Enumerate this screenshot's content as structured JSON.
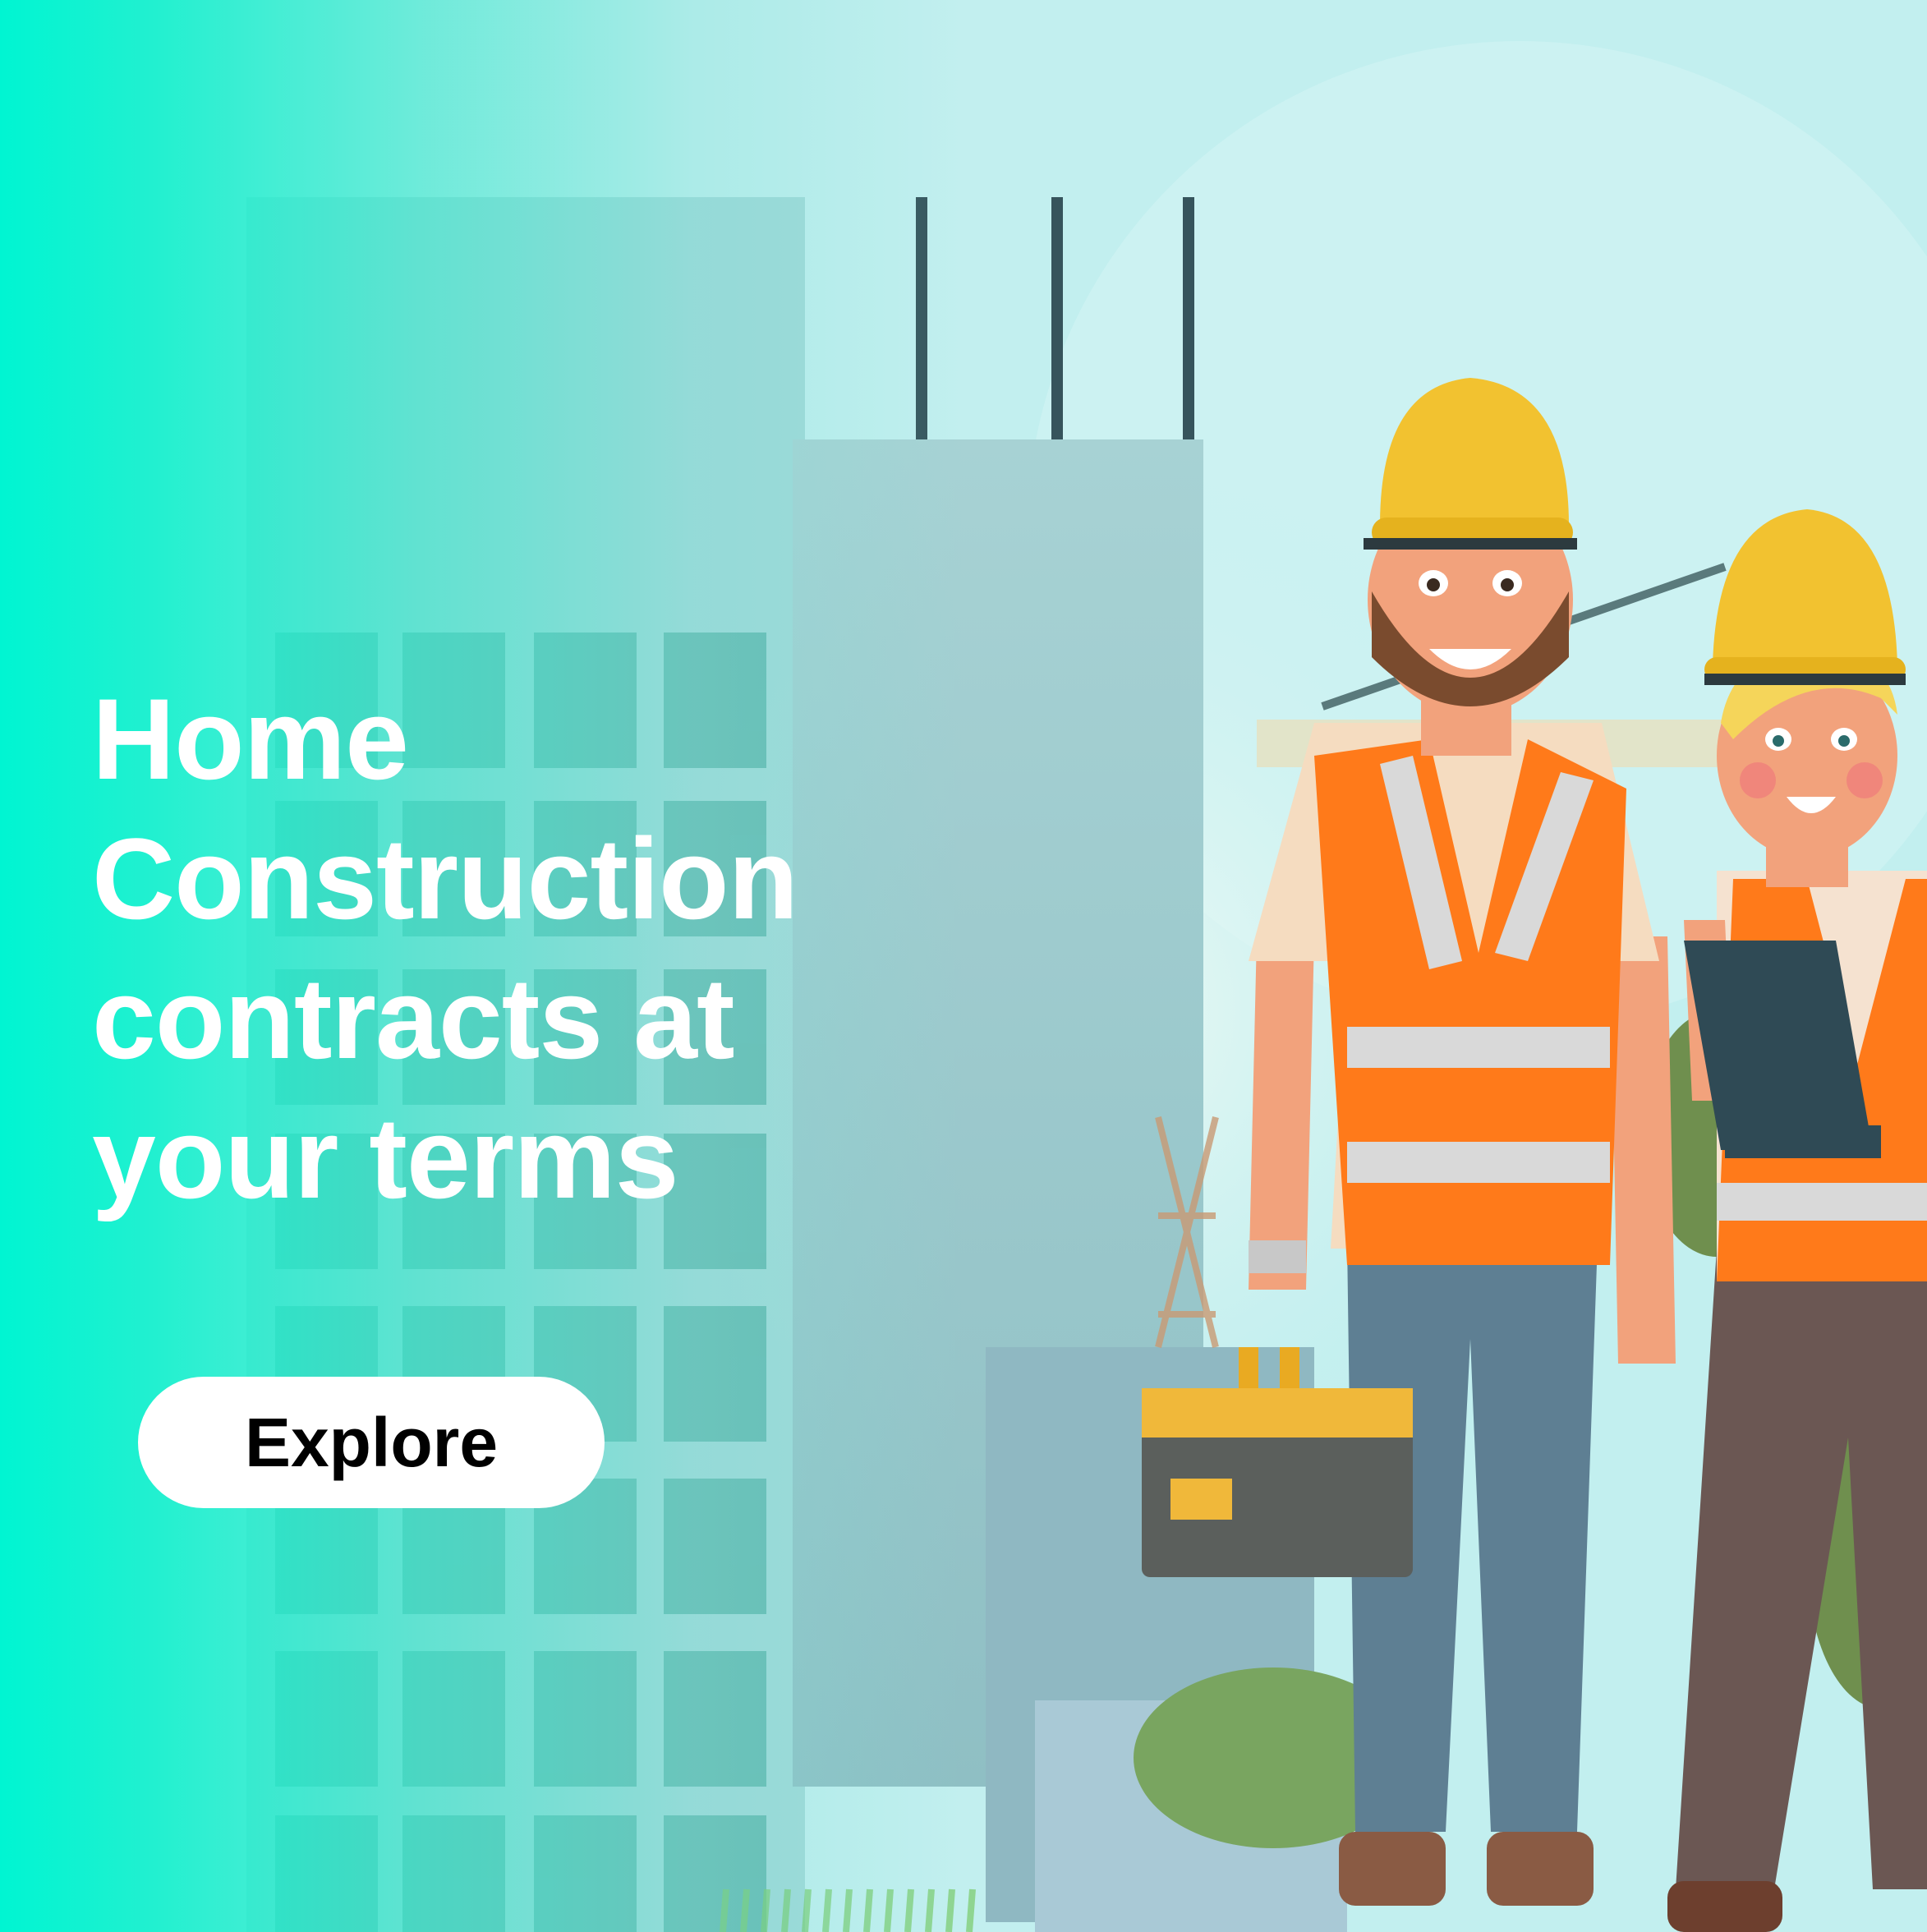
{
  "banner": {
    "headline_lines": [
      "Home",
      "Construction",
      "contracts at",
      "your terms"
    ],
    "cta_label": "Explore"
  },
  "illustration": {
    "subject": "two construction workers in hard hats and safety vests in front of a building under construction",
    "icons": [
      "hard-hat-icon",
      "toolbox-icon",
      "clipboard-icon",
      "crane-icon",
      "building-icon"
    ]
  },
  "colors": {
    "accent_left": "#00f5d2",
    "sky": "#bfeeee",
    "hard_hat": "#f2c230",
    "vest": "#ff7a1a",
    "reflective_stripe": "#d9d9d9",
    "button_bg": "#ffffff",
    "button_text": "#000000",
    "headline_text": "#ffffff"
  }
}
